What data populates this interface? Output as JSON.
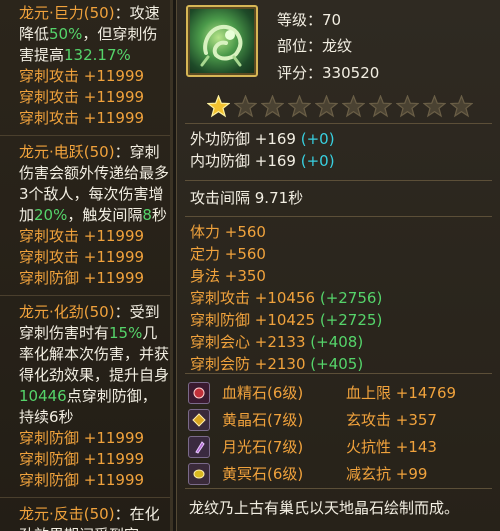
{
  "skills": [
    {
      "name": "龙元·巨力(50)",
      "desc_pre": "：攻速降低",
      "hl1": "50%",
      "desc_mid": "，但穿刺伤害提高",
      "hl2": "132.17%",
      "desc_post": "",
      "stats": [
        "穿刺攻击 +11999",
        "穿刺攻击 +11999",
        "穿刺攻击 +11999"
      ]
    },
    {
      "name": "龙元·电跃(50)",
      "desc_pre": "：穿刺伤害会额外传递给最多3个敌人，每次伤害增加",
      "hl1": "20%",
      "desc_mid": "，触发间隔",
      "hl2": "8",
      "desc_post": "秒",
      "stats": [
        "穿刺攻击 +11999",
        "穿刺攻击 +11999",
        "穿刺防御 +11999"
      ]
    },
    {
      "name": "龙元·化劲(50)",
      "desc_pre": "：受到穿刺伤害时有",
      "hl1": "15%",
      "desc_mid": "几率化解本次伤害，并获得化劲效果，提升自身",
      "hl2": "10446",
      "desc_post": "点穿刺防御，持续6秒",
      "stats": [
        "穿刺防御 +11999",
        "穿刺防御 +11999",
        "穿刺防御 +11999"
      ]
    },
    {
      "name": "龙元·反击(50)",
      "desc_pre": "：在化劲效果期间受到穿",
      "hl1": "",
      "desc_mid": "",
      "hl2": "",
      "desc_post": "",
      "stats": []
    }
  ],
  "item": {
    "icon": "jade-dragon-icon",
    "level_label": "等级：",
    "level": "70",
    "part_label": "部位：",
    "part": "龙纹",
    "score_label": "评分：",
    "score": "330520",
    "stars_total": 10,
    "stars_filled": 1
  },
  "defense": [
    {
      "label": "外功防御 +169",
      "bonus": "(+0)"
    },
    {
      "label": "内功防御 +169",
      "bonus": "(+0)"
    }
  ],
  "interval": "攻击间隔 9.71秒",
  "base_attrs": [
    "体力 +560",
    "定力 +560",
    "身法 +350"
  ],
  "extra_attrs": [
    {
      "label": "穿刺攻击 +10456",
      "bonus": "(+2756)"
    },
    {
      "label": "穿刺防御 +10425",
      "bonus": "(+2725)"
    },
    {
      "label": "穿刺会心 +2133",
      "bonus": "(+408)"
    },
    {
      "label": "穿刺会防 +2130",
      "bonus": "(+405)"
    }
  ],
  "gems": [
    {
      "icon": "blood-gem-icon",
      "color": "#c0303a",
      "name": "血精石(6级)",
      "effect": "血上限 +14769"
    },
    {
      "icon": "yellow-gem-icon",
      "color": "#d9a520",
      "name": "黄晶石(7级)",
      "effect": "玄攻击 +357"
    },
    {
      "icon": "moon-gem-icon",
      "color": "#b06ad0",
      "name": "月光石(7级)",
      "effect": "火抗性 +143"
    },
    {
      "icon": "amber-gem-icon",
      "color": "#d9b820",
      "name": "黄冥石(6级)",
      "effect": "减玄抗 +99"
    }
  ],
  "footer": "龙纹乃上古有巢氏以天地晶石绘制而成。"
}
